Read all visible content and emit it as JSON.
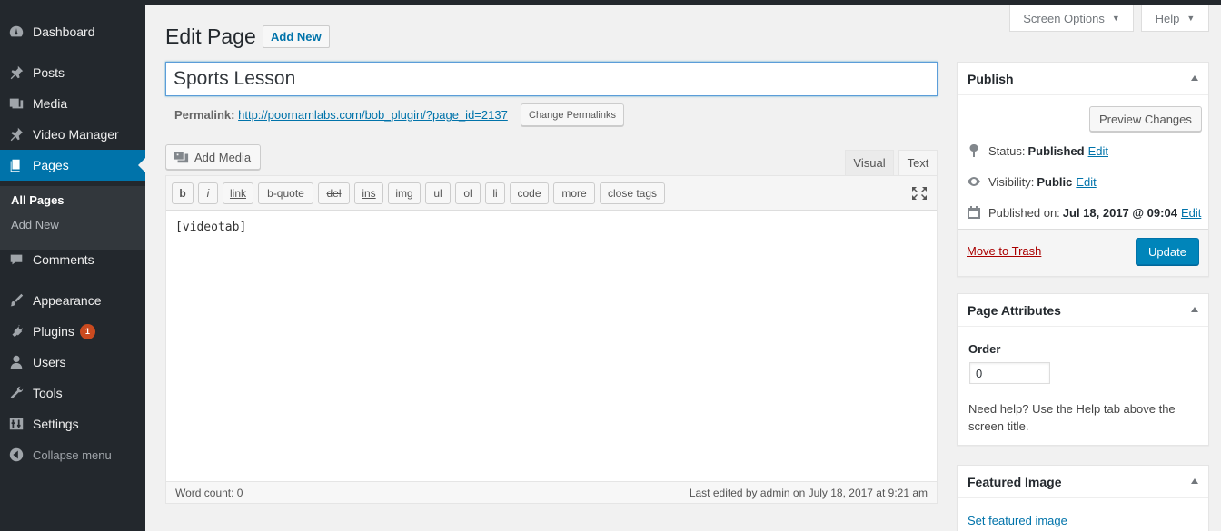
{
  "sidebar": {
    "items": [
      {
        "label": "Dashboard",
        "icon": "dashboard-icon"
      },
      {
        "label": "Posts",
        "icon": "pin-icon"
      },
      {
        "label": "Media",
        "icon": "media-icon"
      },
      {
        "label": "Video Manager",
        "icon": "pin-icon"
      },
      {
        "label": "Pages",
        "icon": "pages-icon"
      },
      {
        "label": "Comments",
        "icon": "comment-icon"
      },
      {
        "label": "Appearance",
        "icon": "brush-icon"
      },
      {
        "label": "Plugins",
        "icon": "plugin-icon",
        "badge": "1"
      },
      {
        "label": "Users",
        "icon": "user-icon"
      },
      {
        "label": "Tools",
        "icon": "wrench-icon"
      },
      {
        "label": "Settings",
        "icon": "settings-icon"
      }
    ],
    "submenu": [
      "All Pages",
      "Add New"
    ],
    "collapse_label": "Collapse menu"
  },
  "top_tabs": {
    "screen_options": "Screen Options",
    "help": "Help"
  },
  "header": {
    "title": "Edit Page",
    "add_new": "Add New"
  },
  "post": {
    "title": "Sports Lesson",
    "permalink_label": "Permalink:",
    "permalink_url": "http://poornamlabs.com/bob_plugin/?page_id=2137",
    "change_permalinks": "Change Permalinks"
  },
  "editor": {
    "add_media": "Add Media",
    "tabs": {
      "visual": "Visual",
      "text": "Text"
    },
    "quicktags": [
      "b",
      "i",
      "link",
      "b-quote",
      "del",
      "ins",
      "img",
      "ul",
      "ol",
      "li",
      "code",
      "more",
      "close tags"
    ],
    "content": "[videotab]",
    "word_count": "Word count: 0",
    "last_edited": "Last edited by admin on July 18, 2017 at 9:21 am"
  },
  "publish": {
    "title": "Publish",
    "preview": "Preview Changes",
    "status_label": "Status:",
    "status_value": "Published",
    "visibility_label": "Visibility:",
    "visibility_value": "Public",
    "published_label": "Published on:",
    "published_value": "Jul 18, 2017 @ 09:04",
    "edit": "Edit",
    "trash": "Move to Trash",
    "update": "Update"
  },
  "attributes": {
    "title": "Page Attributes",
    "order_label": "Order",
    "order_value": "0",
    "help_text": "Need help? Use the Help tab above the screen title."
  },
  "featured": {
    "title": "Featured Image",
    "link": "Set featured image"
  },
  "colors": {
    "sidebar": "#23282d",
    "active": "#0073aa",
    "button_primary": "#0085ba",
    "badge": "#ca4a1f"
  }
}
